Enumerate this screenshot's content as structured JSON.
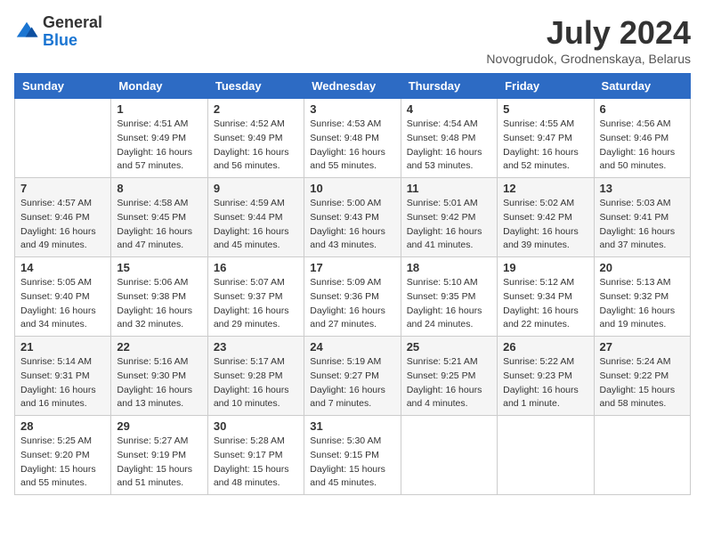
{
  "header": {
    "logo_line1": "General",
    "logo_line2": "Blue",
    "month_title": "July 2024",
    "location": "Novogrudok, Grodnenskaya, Belarus"
  },
  "days_of_week": [
    "Sunday",
    "Monday",
    "Tuesday",
    "Wednesday",
    "Thursday",
    "Friday",
    "Saturday"
  ],
  "weeks": [
    [
      {
        "day": "",
        "info": ""
      },
      {
        "day": "1",
        "info": "Sunrise: 4:51 AM\nSunset: 9:49 PM\nDaylight: 16 hours\nand 57 minutes."
      },
      {
        "day": "2",
        "info": "Sunrise: 4:52 AM\nSunset: 9:49 PM\nDaylight: 16 hours\nand 56 minutes."
      },
      {
        "day": "3",
        "info": "Sunrise: 4:53 AM\nSunset: 9:48 PM\nDaylight: 16 hours\nand 55 minutes."
      },
      {
        "day": "4",
        "info": "Sunrise: 4:54 AM\nSunset: 9:48 PM\nDaylight: 16 hours\nand 53 minutes."
      },
      {
        "day": "5",
        "info": "Sunrise: 4:55 AM\nSunset: 9:47 PM\nDaylight: 16 hours\nand 52 minutes."
      },
      {
        "day": "6",
        "info": "Sunrise: 4:56 AM\nSunset: 9:46 PM\nDaylight: 16 hours\nand 50 minutes."
      }
    ],
    [
      {
        "day": "7",
        "info": "Sunrise: 4:57 AM\nSunset: 9:46 PM\nDaylight: 16 hours\nand 49 minutes."
      },
      {
        "day": "8",
        "info": "Sunrise: 4:58 AM\nSunset: 9:45 PM\nDaylight: 16 hours\nand 47 minutes."
      },
      {
        "day": "9",
        "info": "Sunrise: 4:59 AM\nSunset: 9:44 PM\nDaylight: 16 hours\nand 45 minutes."
      },
      {
        "day": "10",
        "info": "Sunrise: 5:00 AM\nSunset: 9:43 PM\nDaylight: 16 hours\nand 43 minutes."
      },
      {
        "day": "11",
        "info": "Sunrise: 5:01 AM\nSunset: 9:42 PM\nDaylight: 16 hours\nand 41 minutes."
      },
      {
        "day": "12",
        "info": "Sunrise: 5:02 AM\nSunset: 9:42 PM\nDaylight: 16 hours\nand 39 minutes."
      },
      {
        "day": "13",
        "info": "Sunrise: 5:03 AM\nSunset: 9:41 PM\nDaylight: 16 hours\nand 37 minutes."
      }
    ],
    [
      {
        "day": "14",
        "info": "Sunrise: 5:05 AM\nSunset: 9:40 PM\nDaylight: 16 hours\nand 34 minutes."
      },
      {
        "day": "15",
        "info": "Sunrise: 5:06 AM\nSunset: 9:38 PM\nDaylight: 16 hours\nand 32 minutes."
      },
      {
        "day": "16",
        "info": "Sunrise: 5:07 AM\nSunset: 9:37 PM\nDaylight: 16 hours\nand 29 minutes."
      },
      {
        "day": "17",
        "info": "Sunrise: 5:09 AM\nSunset: 9:36 PM\nDaylight: 16 hours\nand 27 minutes."
      },
      {
        "day": "18",
        "info": "Sunrise: 5:10 AM\nSunset: 9:35 PM\nDaylight: 16 hours\nand 24 minutes."
      },
      {
        "day": "19",
        "info": "Sunrise: 5:12 AM\nSunset: 9:34 PM\nDaylight: 16 hours\nand 22 minutes."
      },
      {
        "day": "20",
        "info": "Sunrise: 5:13 AM\nSunset: 9:32 PM\nDaylight: 16 hours\nand 19 minutes."
      }
    ],
    [
      {
        "day": "21",
        "info": "Sunrise: 5:14 AM\nSunset: 9:31 PM\nDaylight: 16 hours\nand 16 minutes."
      },
      {
        "day": "22",
        "info": "Sunrise: 5:16 AM\nSunset: 9:30 PM\nDaylight: 16 hours\nand 13 minutes."
      },
      {
        "day": "23",
        "info": "Sunrise: 5:17 AM\nSunset: 9:28 PM\nDaylight: 16 hours\nand 10 minutes."
      },
      {
        "day": "24",
        "info": "Sunrise: 5:19 AM\nSunset: 9:27 PM\nDaylight: 16 hours\nand 7 minutes."
      },
      {
        "day": "25",
        "info": "Sunrise: 5:21 AM\nSunset: 9:25 PM\nDaylight: 16 hours\nand 4 minutes."
      },
      {
        "day": "26",
        "info": "Sunrise: 5:22 AM\nSunset: 9:23 PM\nDaylight: 16 hours\nand 1 minute."
      },
      {
        "day": "27",
        "info": "Sunrise: 5:24 AM\nSunset: 9:22 PM\nDaylight: 15 hours\nand 58 minutes."
      }
    ],
    [
      {
        "day": "28",
        "info": "Sunrise: 5:25 AM\nSunset: 9:20 PM\nDaylight: 15 hours\nand 55 minutes."
      },
      {
        "day": "29",
        "info": "Sunrise: 5:27 AM\nSunset: 9:19 PM\nDaylight: 15 hours\nand 51 minutes."
      },
      {
        "day": "30",
        "info": "Sunrise: 5:28 AM\nSunset: 9:17 PM\nDaylight: 15 hours\nand 48 minutes."
      },
      {
        "day": "31",
        "info": "Sunrise: 5:30 AM\nSunset: 9:15 PM\nDaylight: 15 hours\nand 45 minutes."
      },
      {
        "day": "",
        "info": ""
      },
      {
        "day": "",
        "info": ""
      },
      {
        "day": "",
        "info": ""
      }
    ]
  ]
}
